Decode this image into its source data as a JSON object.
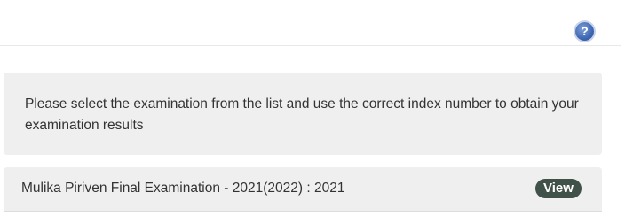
{
  "header": {
    "help_icon": "question-circle-icon",
    "help_symbol": "?"
  },
  "instructions": {
    "text": "Please select the examination from the list and use the correct index number to obtain your examination results"
  },
  "exams": [
    {
      "title": "Mulika Piriven Final Examination - 2021(2022) : 2021",
      "action_label": "View"
    }
  ],
  "colors": {
    "panel_background": "#efefef",
    "view_button": "#3f5149",
    "help_icon": "#3f67b3"
  }
}
